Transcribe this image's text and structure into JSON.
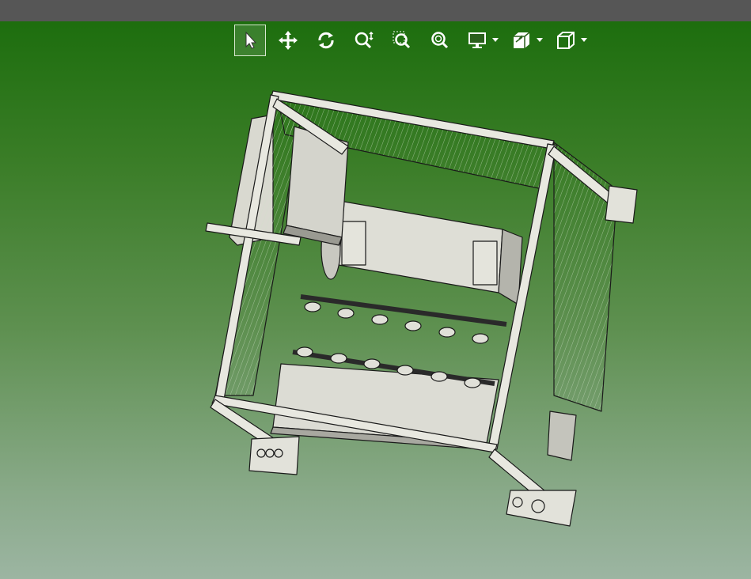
{
  "toolbar": {
    "tools": [
      {
        "id": "select",
        "icon": "pointer-arrow-icon",
        "active": true
      },
      {
        "id": "pan",
        "icon": "move-arrows-icon",
        "active": false
      },
      {
        "id": "rotate",
        "icon": "rotate-icon",
        "active": false
      },
      {
        "id": "zoom-dynamic",
        "icon": "zoom-updown-icon",
        "active": false
      },
      {
        "id": "zoom-window",
        "icon": "zoom-box-icon",
        "active": false
      },
      {
        "id": "zoom-fit",
        "icon": "zoom-fit-icon",
        "active": false
      },
      {
        "id": "display",
        "icon": "monitor-icon",
        "dropdown": true
      },
      {
        "id": "section",
        "icon": "section-cube-icon",
        "dropdown": true
      },
      {
        "id": "view-orientation",
        "icon": "cube-view-icon",
        "dropdown": true
      }
    ]
  },
  "colors": {
    "title_bar": "#565656",
    "background_top": "#1d6e0e",
    "background_bottom": "#9cb5a2",
    "model_fill": "#d8d8d0",
    "model_edge": "#1a1a1a"
  }
}
